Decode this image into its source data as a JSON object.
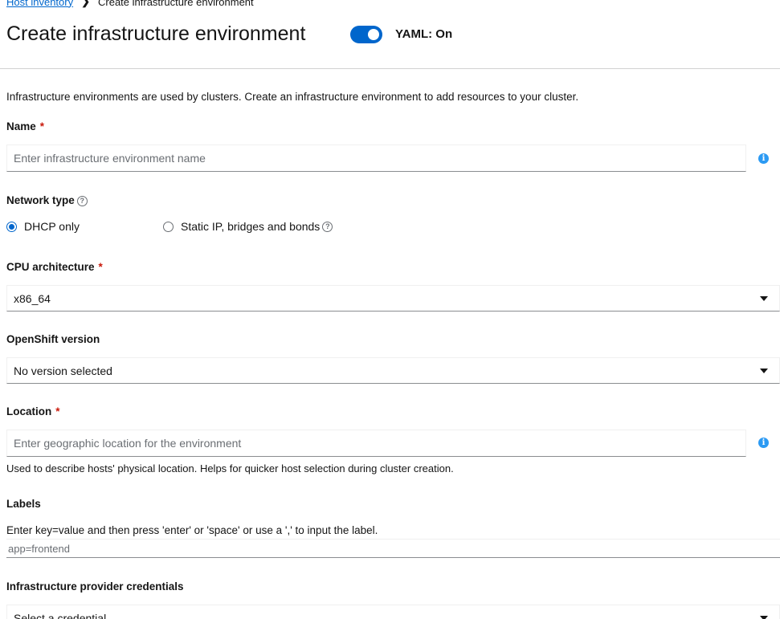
{
  "breadcrumb": {
    "link": "Host inventory",
    "current": "Create infrastructure environment"
  },
  "header": {
    "title": "Create infrastructure environment",
    "yaml_label": "YAML: On",
    "yaml_on": true
  },
  "form": {
    "description": "Infrastructure environments are used by clusters. Create an infrastructure environment to add resources to your cluster.",
    "name": {
      "label": "Name",
      "required_marker": "*",
      "placeholder": "Enter infrastructure environment name",
      "value": ""
    },
    "network_type": {
      "label": "Network type",
      "options": [
        {
          "label": "DHCP only",
          "selected": true
        },
        {
          "label": "Static IP, bridges and bonds",
          "selected": false
        }
      ]
    },
    "cpu_architecture": {
      "label": "CPU architecture",
      "required_marker": "*",
      "value": "x86_64"
    },
    "openshift_version": {
      "label": "OpenShift version",
      "value": "No version selected"
    },
    "location": {
      "label": "Location",
      "required_marker": "*",
      "placeholder": "Enter geographic location for the environment",
      "helper": "Used to describe hosts' physical location. Helps for quicker host selection during cluster creation."
    },
    "labels": {
      "label": "Labels",
      "helper": "Enter key=value and then press 'enter' or 'space' or use a ',' to input the label.",
      "placeholder": "app=frontend"
    },
    "credentials": {
      "label": "Infrastructure provider credentials",
      "placeholder": "Select a credential"
    }
  },
  "colors": {
    "accent": "#0066cc",
    "required": "#c9190b",
    "info": "#2b9af3"
  }
}
